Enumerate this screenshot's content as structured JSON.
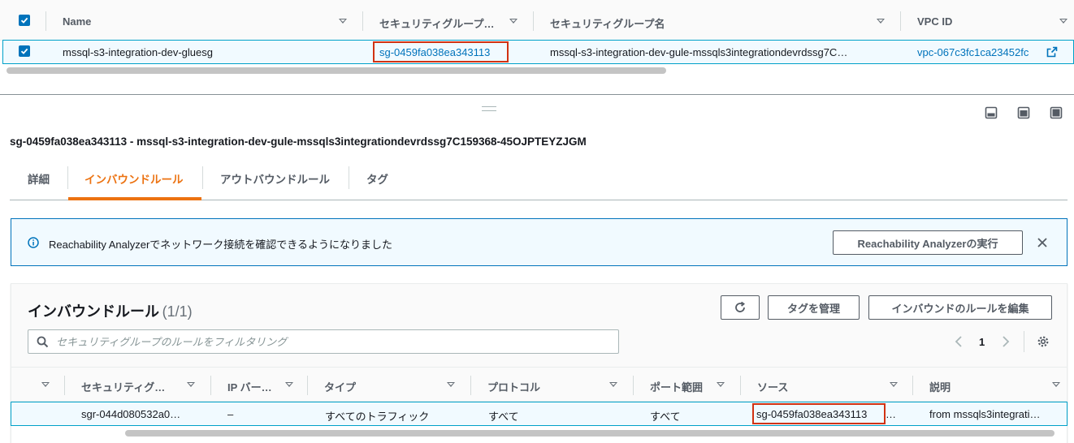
{
  "top_table": {
    "columns": [
      {
        "label": "Name"
      },
      {
        "label": "セキュリティグループ…"
      },
      {
        "label": "セキュリティグループ名"
      },
      {
        "label": "VPC ID"
      }
    ],
    "row": {
      "name": "mssql-s3-integration-dev-gluesg",
      "sg_id": "sg-0459fa038ea343113",
      "sg_name": "mssql-s3-integration-dev-gule-mssqls3integrationdevrdssg7C…",
      "vpc_id": "vpc-067c3fc1ca23452fc"
    }
  },
  "detail": {
    "title": "sg-0459fa038ea343113 - mssql-s3-integration-dev-gule-mssqls3integrationdevrdssg7C159368-45OJPTEYZJGM",
    "tabs": [
      {
        "label": "詳細",
        "active": false
      },
      {
        "label": "インバウンドルール",
        "active": true
      },
      {
        "label": "アウトバウンドルール",
        "active": false
      },
      {
        "label": "タグ",
        "active": false
      }
    ]
  },
  "info_banner": {
    "text": "Reachability Analyzerでネットワーク接続を確認できるようになりました",
    "button_label": "Reachability Analyzerの実行"
  },
  "rules_panel": {
    "title": "インバウンドルール",
    "count": "(1/1)",
    "buttons": {
      "manage_tags": "タグを管理",
      "edit_rules": "インバウンドのルールを編集"
    },
    "filter_placeholder": "セキュリティグループのルールをフィルタリング",
    "page_number": "1",
    "columns": [
      {
        "label": "セキュリティグ…"
      },
      {
        "label": "IP バー…"
      },
      {
        "label": "タイプ"
      },
      {
        "label": "プロトコル"
      },
      {
        "label": "ポート範囲"
      },
      {
        "label": "ソース"
      },
      {
        "label": "説明"
      }
    ],
    "rows": [
      {
        "rule_id": "sgr-044d080532a0…",
        "ip_version": "–",
        "type": "すべてのトラフィック",
        "protocol": "すべて",
        "port_range": "すべて",
        "source": "sg-0459fa038ea343113",
        "source_suffix": "…",
        "description": "from mssqls3integrati…"
      }
    ]
  },
  "colors": {
    "link": "#0073bb",
    "active_tab": "#ec7211",
    "selected_row_bg": "#f1faff",
    "selected_row_border": "#00a1c9",
    "highlight_box": "#d13212",
    "info_bg": "#f1faff"
  }
}
